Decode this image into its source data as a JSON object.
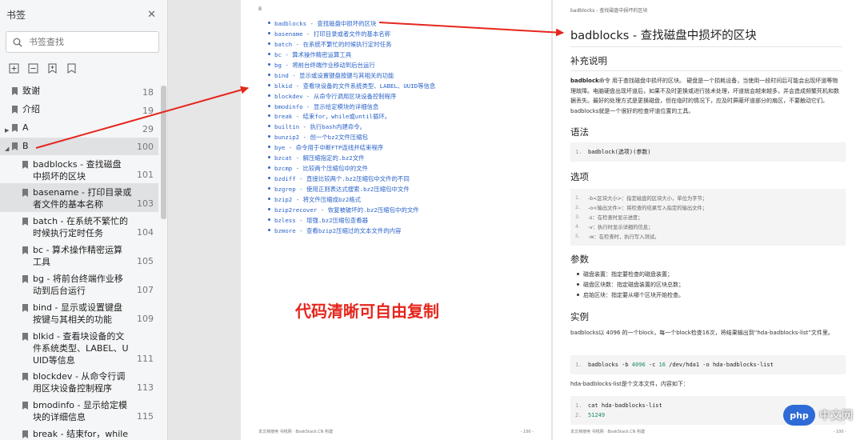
{
  "sidebar": {
    "title": "书签",
    "search_placeholder": "书签查找",
    "items": [
      {
        "label": "致谢",
        "page": "18"
      },
      {
        "label": "介绍",
        "page": "19"
      },
      {
        "label": "A",
        "page": "29"
      },
      {
        "label": "B",
        "page": "100"
      },
      {
        "label": "badblocks - 查找损坏的区块",
        "line1": "badblocks - 查找磁盘",
        "line2": "中损坏的区块",
        "page": "101"
      },
      {
        "label": "basename - 打印目录或者文件的基本名称",
        "line1": "basename - 打印目录或",
        "line2": "者文件的基本名称",
        "page": "103"
      },
      {
        "label": "batch - 在系统不繁忙的时候执行定时任务",
        "line1": "batch - 在系统不繁忙的",
        "line2": "时候执行定时任务",
        "page": "104"
      },
      {
        "label": "bc - 算术操作精密运算工具",
        "line1": "bc - 算术操作精密运算",
        "line2": "工具",
        "page": "105"
      },
      {
        "label": "bg - 将前台终端作业移动到后台运行",
        "line1": "bg - 将前台终端作业移",
        "line2": "动到后台运行",
        "page": "107"
      },
      {
        "label": "bind - 显示或设置键盘按键与其相关的功能",
        "line1": "bind - 显示或设置键盘",
        "line2": "按键与其相关的功能",
        "page": "109"
      },
      {
        "label": "blkid - 查看块设备的文件系统类型、LABEL、UUID等信息",
        "line1": "blkid - 查看块设备的文",
        "line2": "件系统类型、LABEL、U",
        "line3": "UID等信息",
        "page": "111"
      },
      {
        "label": "blockdev - 从命令行调用区块设备控制程序",
        "line1": "blockdev - 从命令行调",
        "line2": "用区块设备控制程序",
        "page": "113"
      },
      {
        "label": "bmodinfo - 显示给定模块的详细信息",
        "line1": "bmodinfo - 显示给定模",
        "line2": "块的详细信息",
        "page": "115"
      },
      {
        "label": "break - 结束for，while",
        "line1": "break - 结束for，while",
        "page": ""
      }
    ]
  },
  "left_page": {
    "section_letter": "B",
    "links": [
      "badblocks - 查找磁盘中损坏的区块",
      "basename - 打印目录或者文件的基本名称",
      "batch - 在系统不繁忙的时候执行定时任务",
      "bc - 算术操作精密运算工具",
      "bg - 将前台终端作业移动到后台运行",
      "bind - 显示或设置键盘按键与其相关的功能",
      "blkid - 查看块设备的文件系统类型、LABEL、UUID等信息",
      "blockdev - 从命令行调用区块设备控制程序",
      "bmodinfo - 显示给定模块的详细信息",
      "break - 结束for，while或until循环。",
      "builtin - 执行bash内建命令。",
      "bunzip2 - 创一个bz2文件压缩包",
      "bye - 命令用于中断FTP连线并结束程序",
      "bzcat - 解压缩指定的.bz2文件",
      "bzcmp - 比较两个压缩包中的文件",
      "bzdiff - 直接比较两个.bz2压缩包中文件的不同",
      "bzgrep - 使用正则表达式搜索.bz2压缩包中文件",
      "bzip2 - 将文件压缩成bz2格式",
      "bzip2recover - 恢复被破坏的.bz2压缩包中的文件",
      "bzless - 增强.bz2压缩包查看器",
      "bzmore - 查看bzip2压缩过的文本文件的内容"
    ],
    "footer_left": "本文档使用 书栈网 · BookStack.CN 构建",
    "footer_right": "- 100 -"
  },
  "annotation": "代码清晰可自由复制",
  "right_page": {
    "crumb": "badblocks - 查找磁盘中损坏的区块",
    "title": "badblocks - 查找磁盘中损坏的区块",
    "h_supplement": "补充说明",
    "supplement_bold": "badblock",
    "supplement_text": "命令 用于查找磁盘中损坏的区块。 硬盘是一个损耗设备，当使用一段时间后可能会出现坏道等物理故障。电脑硬盘出现坏道后，如果不及时更换或进行技术处理，坏道就会越来越多，并会造成频繁死机和数据丢失。最好的处理方式是更换磁盘，但在临时的情况下，应及时屏蔽坏道部分的扇区，不要触动它们。badblocks就是一个很好的检查坏道位置的工具。",
    "h_syntax": "语法",
    "syntax_code": "badblock(选项)(参数)",
    "h_options": "选项",
    "options": [
      "-b<区块大小>：指定磁盘的区块大小，单位为字节；",
      "-o<输出文件>：将检查的结果写入指定的输出文件；",
      "-s：在检查时显示进度；",
      "-v：执行时显示详细的信息；",
      "-w：在检查时，执行写入测试。"
    ],
    "h_params": "参数",
    "params": [
      "磁盘装置：指定要检查的磁盘装置；",
      "磁盘区块数：指定磁盘装置的区块总数；",
      "启始区块：指定要从哪个区块开始检查。"
    ],
    "h_example": "实例",
    "example_text": "badblocks以 4096 的一个block，每一个block检查16次，将结果输出到“hda-badblocks-list”文件里。",
    "example_code_pre": "badblocks -b ",
    "example_code_n1": "4096",
    "example_code_mid": " -c ",
    "example_code_n2": "16",
    "example_code_post": " /dev/hda1 -o hda-badblocks-list",
    "example_text2": "hda-badblocks-list是个文本文件，内容如下：",
    "example_out1": "cat hda-badblocks-list",
    "example_out2": "51249",
    "footer_left": "本文档使用 书栈网 · BookStack.CN 构建",
    "footer_right": "- 100 -"
  },
  "watermark": {
    "logo": "php",
    "text": "中文网"
  },
  "colors": {
    "link": "#2a63c9",
    "annotation": "#e5261d",
    "arrow": "#e5261d"
  }
}
